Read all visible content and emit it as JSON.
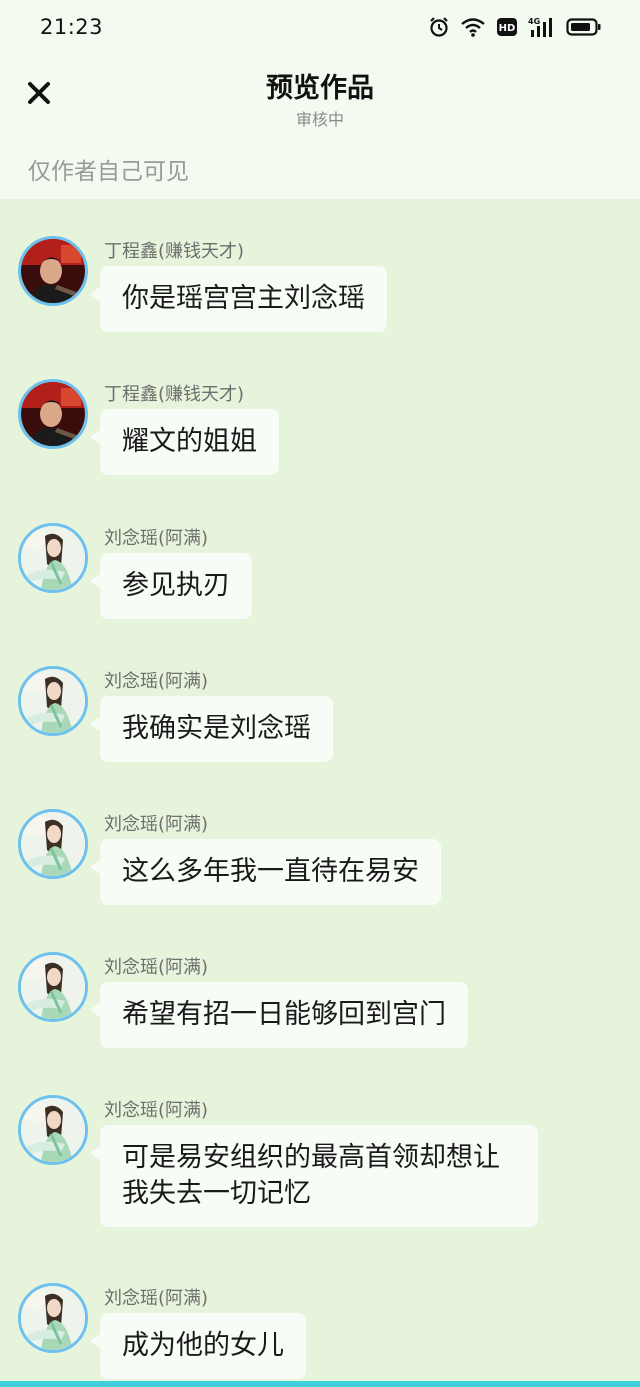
{
  "status_bar": {
    "time": "21:23",
    "icons": [
      "alarm-icon",
      "wifi-icon",
      "hd-icon",
      "signal-4g-icon",
      "battery-icon"
    ],
    "hd_label": "HD",
    "network_label": "4G"
  },
  "header": {
    "close_icon": "close-icon",
    "title": "预览作品",
    "subtitle": "审核中"
  },
  "visibility_note": "仅作者自己可见",
  "colors": {
    "background": "#e6f4dc",
    "header_background": "#f3fbf1",
    "bubble": "#f7fcf6",
    "avatar_border": "#6cc1ee",
    "bottom_accent": "#3fd0dc"
  },
  "messages": [
    {
      "sender": "丁程鑫(赚钱天才)",
      "avatar": "male-character-avatar",
      "text": "你是瑶宫宫主刘念瑶"
    },
    {
      "sender": "丁程鑫(赚钱天才)",
      "avatar": "male-character-avatar",
      "text": "耀文的姐姐"
    },
    {
      "sender": "刘念瑶(阿满)",
      "avatar": "female-character-avatar",
      "text": "参见执刃"
    },
    {
      "sender": "刘念瑶(阿满)",
      "avatar": "female-character-avatar",
      "text": "我确实是刘念瑶"
    },
    {
      "sender": "刘念瑶(阿满)",
      "avatar": "female-character-avatar",
      "text": "这么多年我一直待在易安"
    },
    {
      "sender": "刘念瑶(阿满)",
      "avatar": "female-character-avatar",
      "text": "希望有招一日能够回到宫门"
    },
    {
      "sender": "刘念瑶(阿满)",
      "avatar": "female-character-avatar",
      "text": "可是易安组织的最高首领却想让我失去一切记忆"
    },
    {
      "sender": "刘念瑶(阿满)",
      "avatar": "female-character-avatar",
      "text": "成为他的女儿"
    }
  ]
}
